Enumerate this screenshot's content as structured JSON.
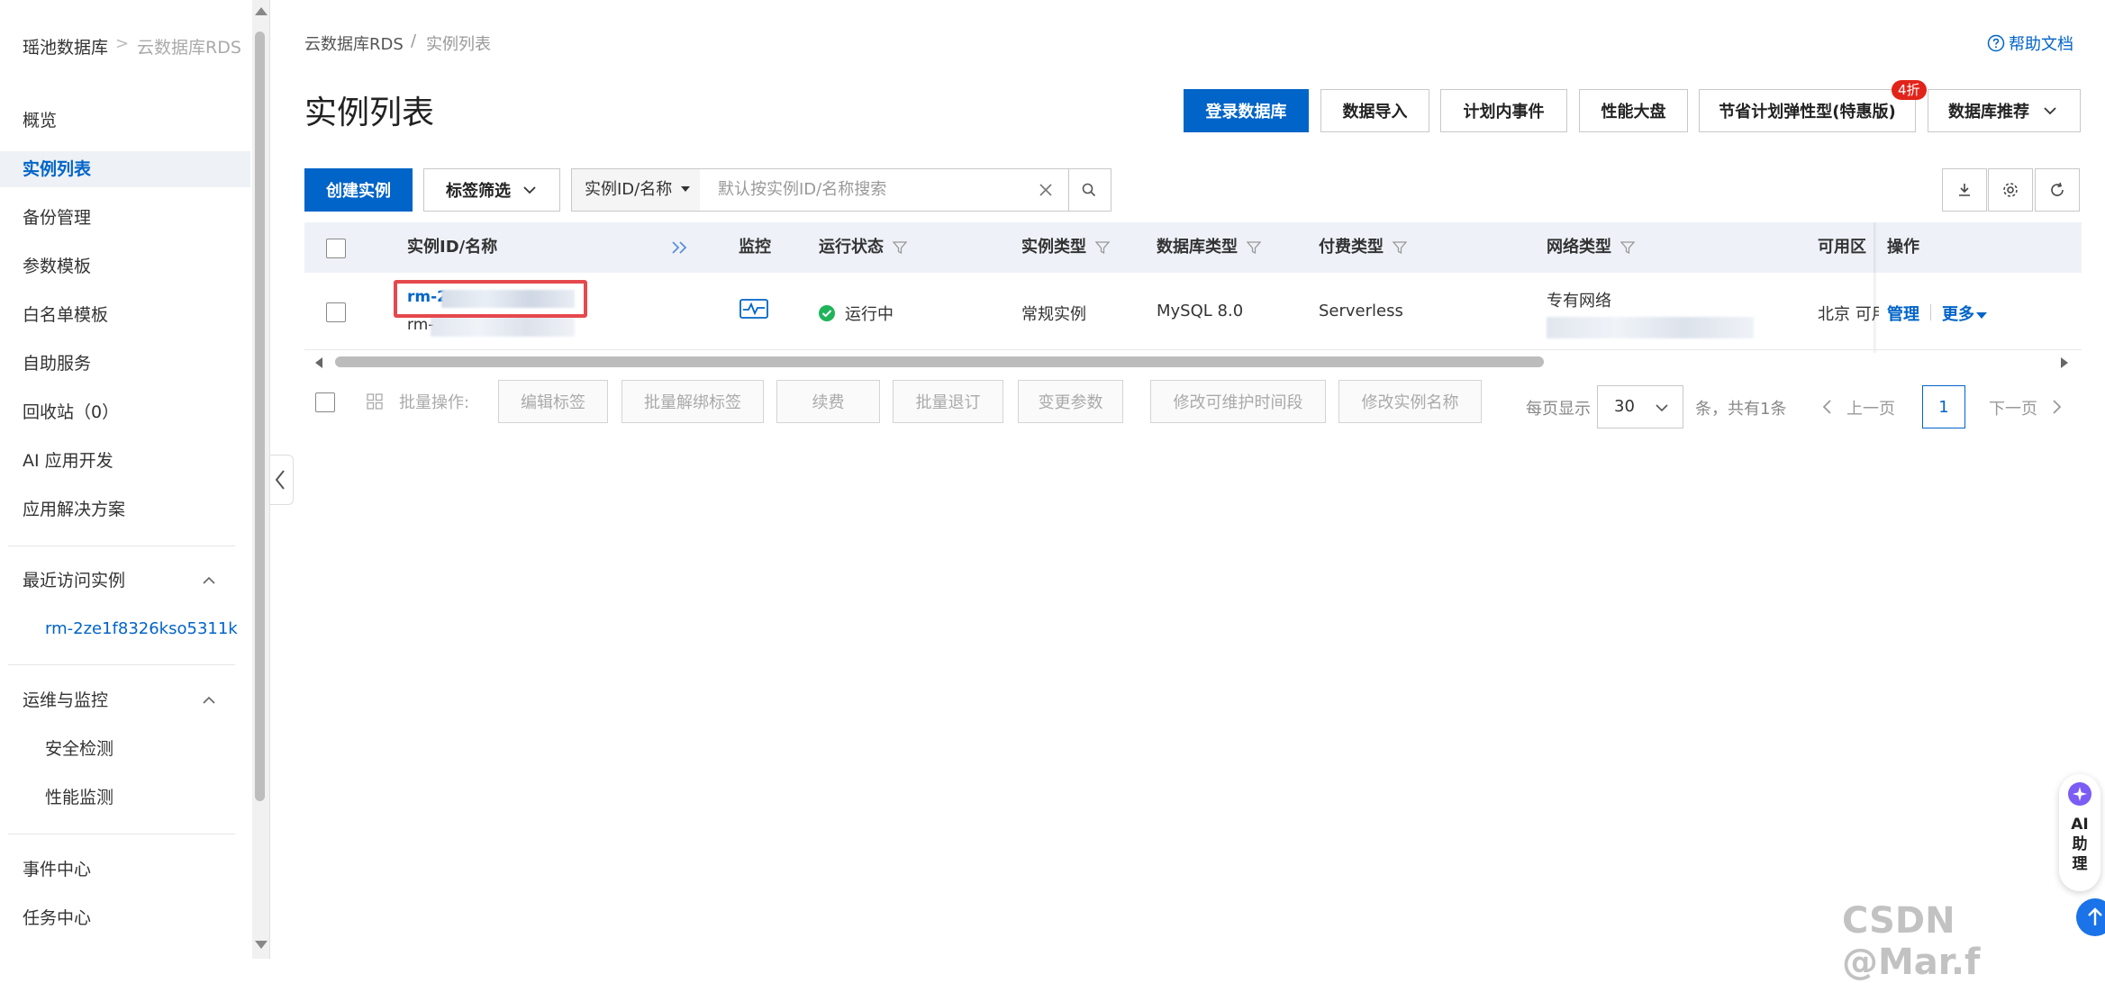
{
  "sidebar": {
    "brand": "瑶池数据库",
    "separator": ">",
    "subtitle": "云数据库RDS",
    "items": [
      {
        "label": "概览"
      },
      {
        "label": "实例列表"
      },
      {
        "label": "备份管理"
      },
      {
        "label": "参数模板"
      },
      {
        "label": "白名单模板"
      },
      {
        "label": "自助服务"
      },
      {
        "label": "回收站（0）"
      },
      {
        "label": "AI 应用开发"
      },
      {
        "label": "应用解决方案"
      }
    ],
    "recent_title": "最近访问实例",
    "recent_instance": "rm-2ze1f8326kso5311k",
    "ops_title": "运维与监控",
    "ops_items": [
      {
        "label": "安全检测"
      },
      {
        "label": "性能监测"
      }
    ],
    "bottom_items": [
      {
        "label": "事件中心"
      },
      {
        "label": "任务中心"
      }
    ]
  },
  "breadcrumb": {
    "root": "云数据库RDS",
    "sep": "/",
    "current": "实例列表"
  },
  "header": {
    "title": "实例列表",
    "help": "帮助文档",
    "actions": {
      "login_db": "登录数据库",
      "data_import": "数据导入",
      "planned_events": "计划内事件",
      "perf_dashboard": "性能大盘",
      "savings_plan": "节省计划弹性型(特惠版)",
      "savings_badge": "4折",
      "db_recommend": "数据库推荐"
    }
  },
  "toolbar": {
    "create": "创建实例",
    "tag_filter": "标签筛选",
    "search_field": "实例ID/名称",
    "search_placeholder": "默认按实例ID/名称搜索"
  },
  "table": {
    "columns": {
      "id": "实例ID/名称",
      "monitor": "监控",
      "status": "运行状态",
      "type": "实例类型",
      "engine": "数据库类型",
      "pay": "付费类型",
      "network": "网络类型",
      "zone": "可用区",
      "ops": "操作"
    },
    "rows": [
      {
        "id_prefix": "rm-2",
        "name_prefix": "rm-",
        "status": "运行中",
        "type": "常规实例",
        "engine": "MySQL 8.0",
        "pay": "Serverless",
        "network": "专有网络",
        "zone": "北京 可用",
        "manage": "管理",
        "more": "更多"
      }
    ]
  },
  "batch": {
    "label": "批量操作:",
    "buttons": {
      "edit_tags": "编辑标签",
      "unbind_tags": "批量解绑标签",
      "renew": "续费",
      "refund": "批量退订",
      "change_params": "变更参数",
      "maint_window": "修改可维护时间段",
      "rename": "修改实例名称"
    }
  },
  "pager": {
    "per_page_label": "每页显示",
    "per_page": "30",
    "total": "条，共有1条",
    "prev": "上一页",
    "current": "1",
    "next": "下一页"
  },
  "assistant": {
    "label": "AI助理"
  },
  "watermark": "CSDN @Mar.f",
  "colors": {
    "accent": "#0064c8",
    "badge": "#e2231a",
    "status_ok": "#1fb45a",
    "highlight": "#e5484d"
  }
}
